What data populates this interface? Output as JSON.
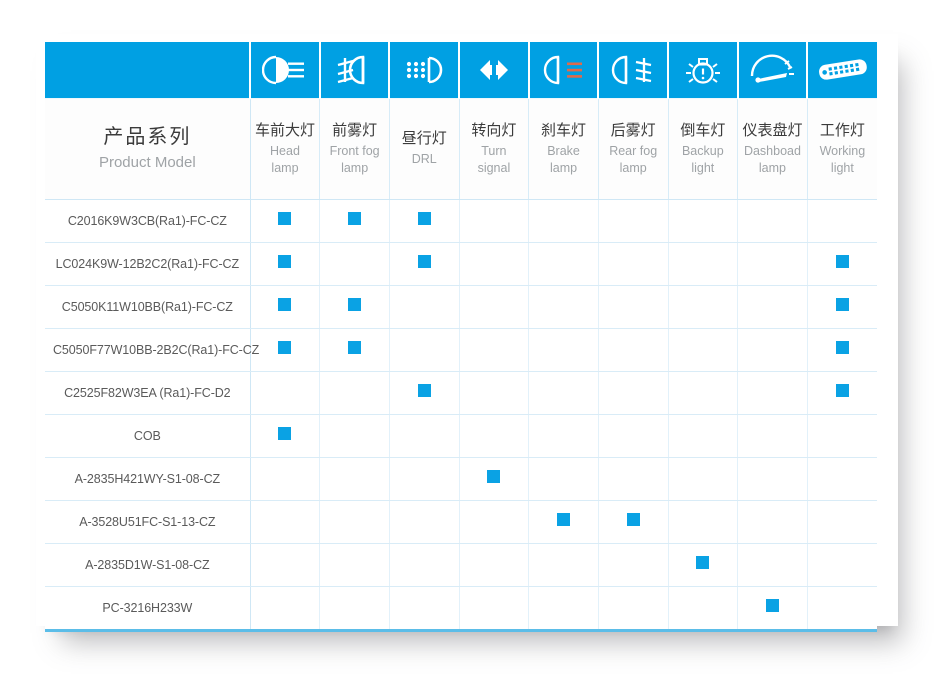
{
  "table": {
    "row_header": {
      "title_cn": "产品系列",
      "title_en": "Product Model"
    },
    "columns": [
      {
        "icon": "head-lamp-icon",
        "cn": "车前大灯",
        "en_line1": "Head",
        "en_line2": "lamp"
      },
      {
        "icon": "front-fog-lamp-icon",
        "cn": "前雾灯",
        "en_line1": "Front fog",
        "en_line2": "lamp"
      },
      {
        "icon": "drl-icon",
        "cn": "昼行灯",
        "en_line1": "DRL",
        "en_line2": ""
      },
      {
        "icon": "turn-signal-icon",
        "cn": "转向灯",
        "en_line1": "Turn",
        "en_line2": "signal"
      },
      {
        "icon": "brake-lamp-icon",
        "cn": "刹车灯",
        "en_line1": "Brake",
        "en_line2": "lamp"
      },
      {
        "icon": "rear-fog-lamp-icon",
        "cn": "后雾灯",
        "en_line1": "Rear fog",
        "en_line2": "lamp"
      },
      {
        "icon": "backup-light-icon",
        "cn": "倒车灯",
        "en_line1": "Backup",
        "en_line2": "light"
      },
      {
        "icon": "dashboard-lamp-icon",
        "cn": "仪表盘灯",
        "en_line1": "Dashboad",
        "en_line2": "lamp"
      },
      {
        "icon": "working-light-icon",
        "cn": "工作灯",
        "en_line1": "Working",
        "en_line2": "light"
      }
    ],
    "rows": [
      {
        "model": "C2016K9W3CB(Ra1)-FC-CZ",
        "marks": [
          1,
          1,
          1,
          0,
          0,
          0,
          0,
          0,
          0
        ]
      },
      {
        "model": "LC024K9W-12B2C2(Ra1)-FC-CZ",
        "marks": [
          1,
          0,
          1,
          0,
          0,
          0,
          0,
          0,
          1
        ]
      },
      {
        "model": "C5050K11W10BB(Ra1)-FC-CZ",
        "marks": [
          1,
          1,
          0,
          0,
          0,
          0,
          0,
          0,
          1
        ]
      },
      {
        "model": "C5050F77W10BB-2B2C(Ra1)-FC-CZ",
        "marks": [
          1,
          1,
          0,
          0,
          0,
          0,
          0,
          0,
          1
        ]
      },
      {
        "model": "C2525F82W3EA (Ra1)-FC-D2",
        "marks": [
          0,
          0,
          1,
          0,
          0,
          0,
          0,
          0,
          1
        ]
      },
      {
        "model": "COB",
        "marks": [
          1,
          0,
          0,
          0,
          0,
          0,
          0,
          0,
          0
        ]
      },
      {
        "model": "A-2835H421WY-S1-08-CZ",
        "marks": [
          0,
          0,
          0,
          1,
          0,
          0,
          0,
          0,
          0
        ]
      },
      {
        "model": "A-3528U51FC-S1-13-CZ",
        "marks": [
          0,
          0,
          0,
          0,
          1,
          1,
          0,
          0,
          0
        ]
      },
      {
        "model": "A-2835D1W-S1-08-CZ",
        "marks": [
          0,
          0,
          0,
          0,
          0,
          0,
          1,
          0,
          0
        ]
      },
      {
        "model": "PC-3216H233W",
        "marks": [
          0,
          0,
          0,
          0,
          0,
          0,
          0,
          1,
          0
        ]
      }
    ]
  },
  "colors": {
    "header_blue": "#00a0e3",
    "mark_blue": "#0aa2e4",
    "column_tint": "#d6ecf9",
    "grid_line": "#d9ecf7",
    "cn_text": "#3b3b3b",
    "en_text": "#9fa3a6",
    "model_text": "#5a5a5a"
  }
}
